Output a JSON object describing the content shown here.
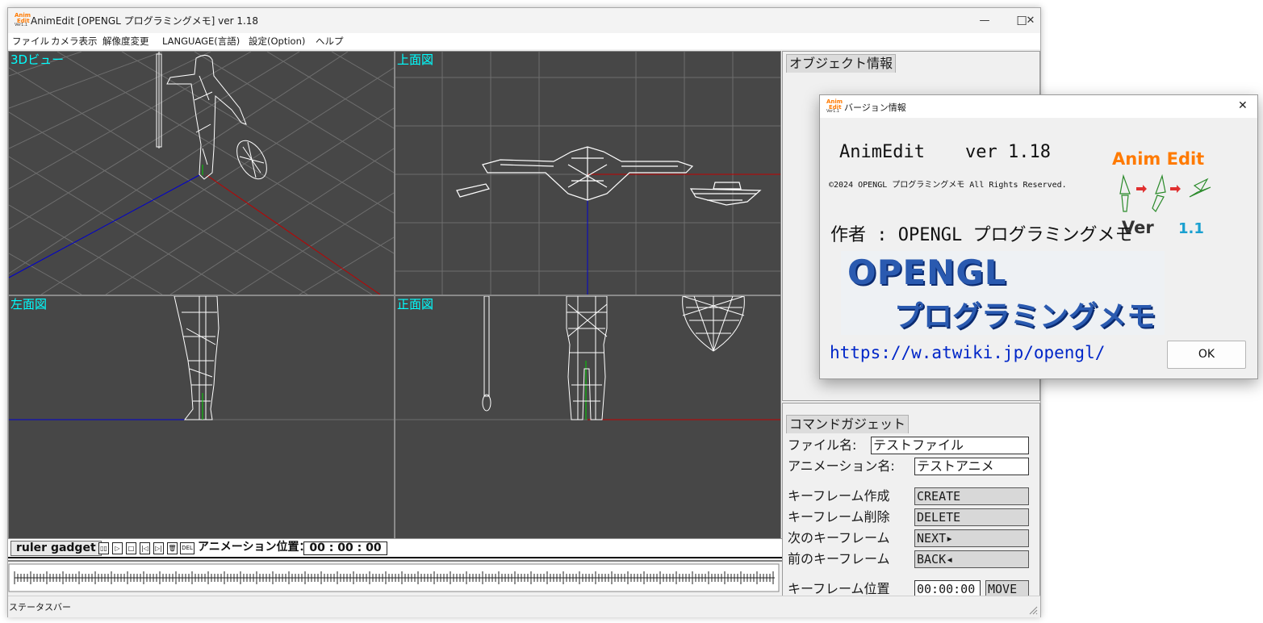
{
  "window": {
    "title": "AnimEdit [OPENGL プログラミングメモ] ver 1.18",
    "app_icon": "animedit-app-icon",
    "app_icon_text": [
      "Anim",
      "Edit",
      "Ver1.1"
    ],
    "controls": {
      "minimize": "—",
      "maximize": "☐",
      "close": "✕"
    }
  },
  "menu": [
    "ファイル",
    "カメラ表示",
    "解像度変更",
    "LANGUAGE(言語)",
    "設定(Option)",
    "ヘルプ"
  ],
  "viewports": {
    "view_3d": "3Dビュー",
    "top": "上面図",
    "left": "左面図",
    "front": "正面図"
  },
  "object_info": {
    "tab": "オブジェクト情報"
  },
  "command_gadget": {
    "tab": "コマンドガジェット",
    "file_label": "ファイル名:",
    "file_value": "テストファイル",
    "anim_label": "アニメーション名:",
    "anim_value": "テストアニメ",
    "create_label": "キーフレーム作成",
    "create_button": "CREATE",
    "delete_label": "キーフレーム削除",
    "delete_button": "DELETE",
    "next_label": "次のキーフレーム",
    "next_button": "NEXT▸",
    "back_label": "前のキーフレーム",
    "back_button": "BACK◂",
    "pos_label": "キーフレーム位置",
    "pos_value": "00:00:00",
    "move_button": "MOVE"
  },
  "ruler": {
    "tab": "ruler gadget",
    "controls": [
      "▯▯",
      "▷",
      "□",
      "|◁",
      "▷|",
      "🗑",
      "DEL"
    ],
    "position_label": "アニメーション位置：",
    "position_value": "00 : 00 : 00"
  },
  "status_bar": "ステータスバー",
  "dialog": {
    "title": "バージョン情報",
    "app_name": "AnimEdit",
    "version": "ver 1.18",
    "copyright": "©2024 OPENGL プログラミングメモ All Rights Reserved.",
    "author": "作者 : OPENGL プログラミングメモ",
    "banner_line1": "OPENGL",
    "banner_line2": "プログラミングメモ",
    "url": "https://w.atwiki.jp/opengl/",
    "ok_button": "OK",
    "logo_title": "Anim Edit",
    "logo_ver": "Ver",
    "logo_num": "1.1"
  },
  "colors": {
    "viewport_bg": "#474747",
    "viewport_label": "#00ffff",
    "axis_x": "#c00000",
    "axis_z": "#0000cc",
    "axis_y": "#00aa00",
    "logo_orange": "#ff7a00",
    "url_blue": "#0026c8"
  }
}
